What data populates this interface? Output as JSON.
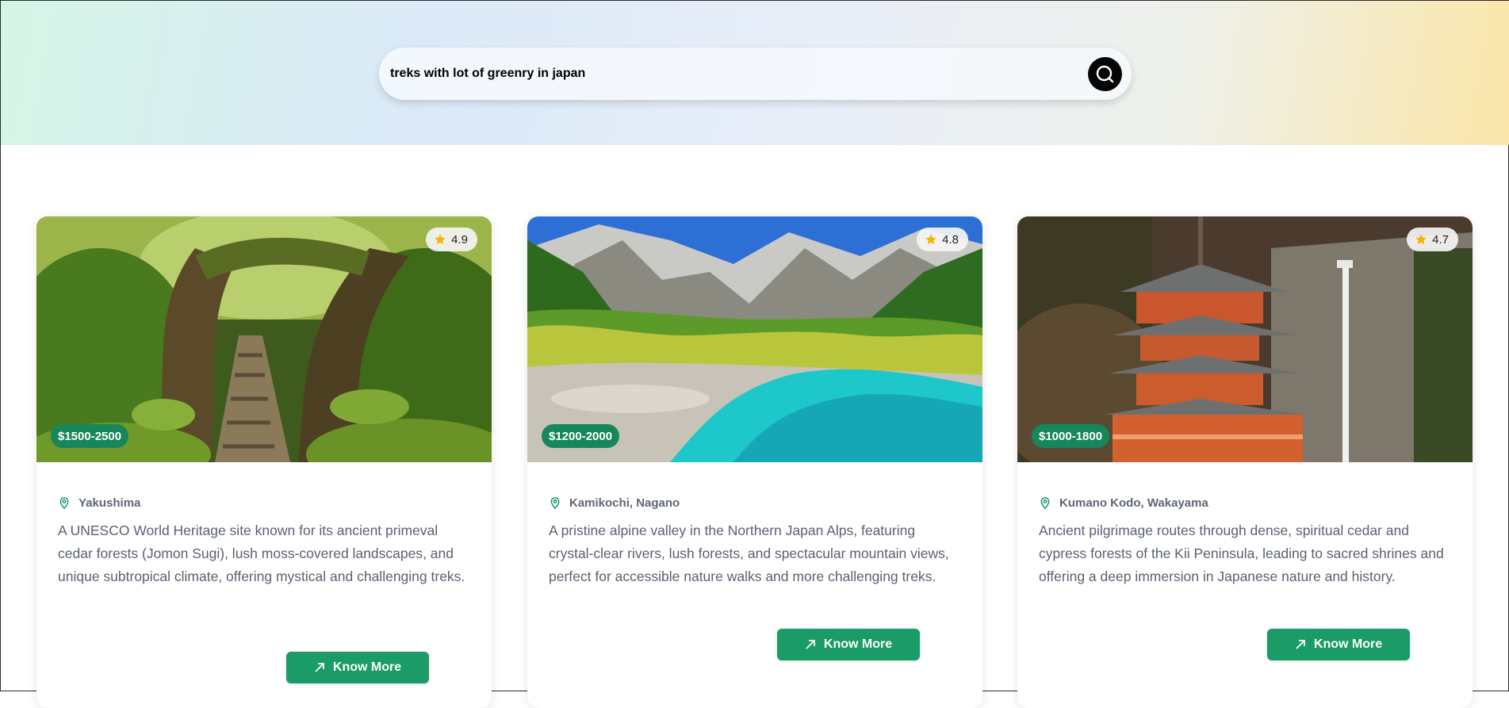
{
  "search": {
    "value": "treks with lot of greenry in japan",
    "button_icon": "search-icon"
  },
  "colors": {
    "accent": "#1a9b68",
    "price_badge": "#16875a",
    "star": "#f5b400"
  },
  "cards": [
    {
      "rating": "4.9",
      "price": "$1500-2500",
      "location": "Yakushima",
      "description": "A UNESCO World Heritage site known for its ancient primeval cedar forests (Jomon Sugi), lush moss-covered landscapes, and unique subtropical climate, offering mystical and challenging treks.",
      "button_label": "Know More",
      "image": "mossy-forest-trail"
    },
    {
      "rating": "4.8",
      "price": "$1200-2000",
      "location": "Kamikochi, Nagano",
      "description": "A pristine alpine valley in the Northern Japan Alps, featuring crystal-clear rivers, lush forests, and spectacular mountain views, perfect for accessible nature walks and more challenging treks.",
      "button_label": "Know More",
      "image": "alpine-river-valley"
    },
    {
      "rating": "4.7",
      "price": "$1000-1800",
      "location": "Kumano Kodo, Wakayama",
      "description": "Ancient pilgrimage routes through dense, spiritual cedar and cypress forests of the Kii Peninsula, leading to sacred shrines and offering a deep immersion in Japanese nature and history.",
      "button_label": "Know More",
      "image": "pagoda-waterfall"
    }
  ]
}
